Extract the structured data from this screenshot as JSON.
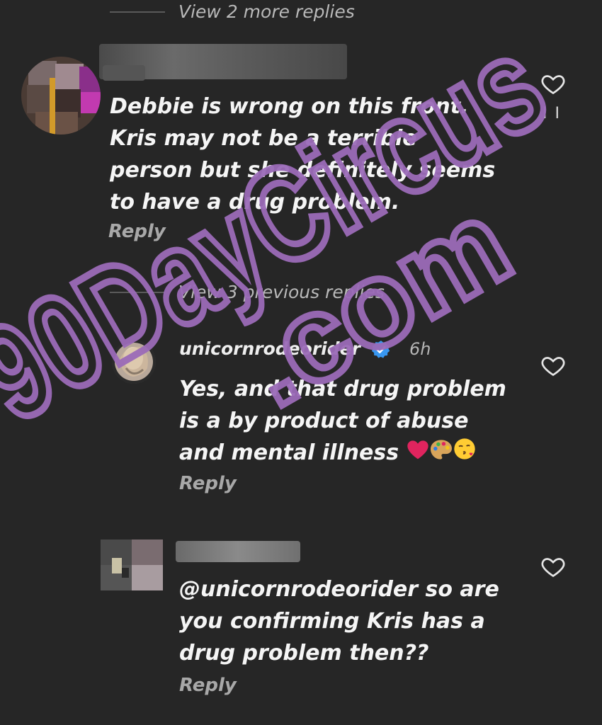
{
  "thread": {
    "view_more_top": "View 2 more replies",
    "view_previous": "View 3 previous replies"
  },
  "comments": [
    {
      "text": "Debbie is wrong on this front. Kris may not be a terrible person but she definitely seems to have a drug problem.",
      "reply_label": "Reply",
      "side_mark": "I I"
    },
    {
      "username": "unicornrodeorider",
      "time": "6h",
      "text": "Yes, and that drug problem is a by product of abuse and mental illness",
      "reply_label": "Reply"
    },
    {
      "text": "@unicornrodeorider so are you confirming Kris has a drug problem then??",
      "reply_label": "Reply"
    }
  ],
  "watermark": {
    "line1": "90DayCircus",
    "line2": ".com",
    "color": "#9b6bb8"
  },
  "icons": {
    "heart": "heart-outline-icon",
    "verified": "verified-badge-icon",
    "emoji_heart": "red-heart-emoji",
    "emoji_palette": "artist-palette-emoji",
    "emoji_kiss": "face-blowing-kiss-emoji"
  },
  "colors": {
    "background": "#262626",
    "verified_blue": "#3897f0",
    "heart_red": "#e0245e"
  }
}
